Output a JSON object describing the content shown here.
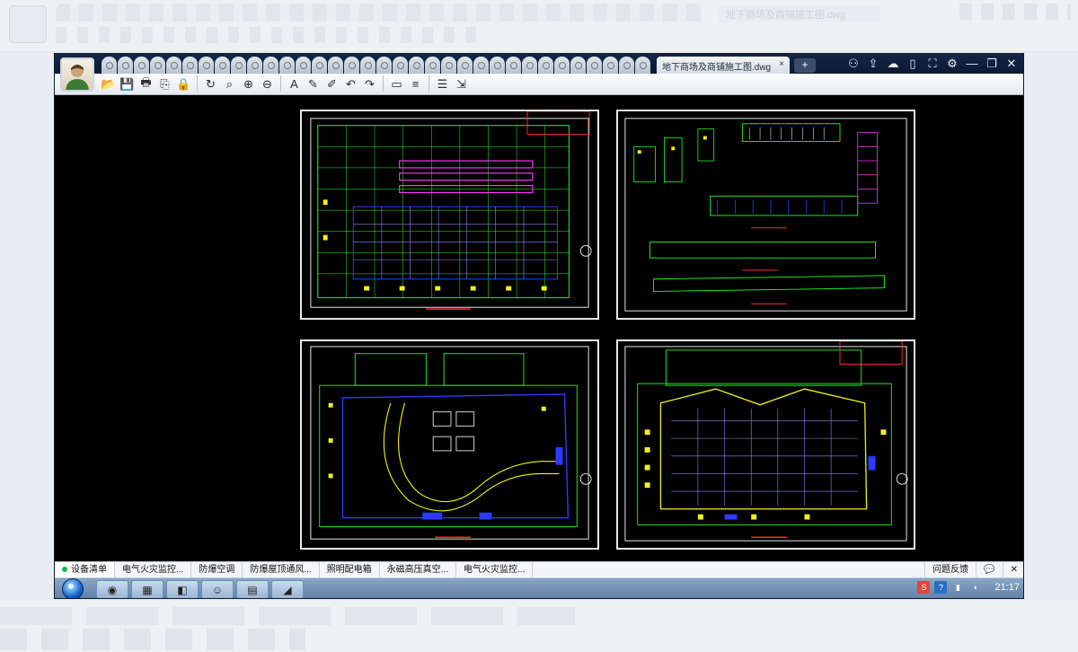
{
  "window": {
    "document_tab": "地下商场及商铺施工图.dwg",
    "close_tab": "×",
    "new_tab": "+",
    "controls": [
      "⚇",
      "⇪",
      "☁",
      "▯",
      "⛶",
      "⚙",
      "—",
      "❐",
      "✕"
    ]
  },
  "toolbar": {
    "tools": [
      {
        "name": "open-icon",
        "glyph": "📂"
      },
      {
        "name": "save-icon",
        "glyph": "💾"
      },
      {
        "name": "print-icon",
        "glyph": "🖶"
      },
      {
        "name": "pdf-icon",
        "glyph": "⎘"
      },
      {
        "name": "lock-icon",
        "glyph": "🔒"
      },
      {
        "sep": true
      },
      {
        "name": "rotate-icon",
        "glyph": "↻"
      },
      {
        "name": "zoom-window-icon",
        "glyph": "⌕"
      },
      {
        "name": "zoom-in-icon",
        "glyph": "⊕"
      },
      {
        "name": "zoom-out-icon",
        "glyph": "⊖"
      },
      {
        "sep": true
      },
      {
        "name": "text-icon",
        "glyph": "A"
      },
      {
        "name": "pencil-icon",
        "glyph": "✎"
      },
      {
        "name": "highlighter-icon",
        "glyph": "✐"
      },
      {
        "name": "undo-icon",
        "glyph": "↶"
      },
      {
        "name": "redo-icon",
        "glyph": "↷"
      },
      {
        "sep": true
      },
      {
        "name": "measure-icon",
        "glyph": "▭"
      },
      {
        "name": "dimension-icon",
        "glyph": "≡"
      },
      {
        "sep": true
      },
      {
        "name": "layers-icon",
        "glyph": "☰"
      },
      {
        "name": "export-icon",
        "glyph": "⇲"
      }
    ]
  },
  "sheets": [
    {
      "id": "plan-a",
      "label": ""
    },
    {
      "id": "elevations",
      "label": ""
    },
    {
      "id": "plan-b",
      "label": ""
    },
    {
      "id": "plan-c",
      "label": ""
    }
  ],
  "sheet_tabs": [
    {
      "label": "设备清单",
      "active": true
    },
    {
      "label": "电气火灾监控...",
      "active": false
    },
    {
      "label": "防爆空调",
      "active": false
    },
    {
      "label": "防爆屋顶通风...",
      "active": false
    },
    {
      "label": "照明配电箱",
      "active": false
    },
    {
      "label": "永磁高压真空...",
      "active": false
    },
    {
      "label": "电气火灾监控...",
      "active": false
    }
  ],
  "sheetbar_right": {
    "feedback": "问题反馈",
    "chat": "💬",
    "close": "✕"
  },
  "taskbar": {
    "start": "",
    "apps": [
      "◉",
      "▦",
      "◧",
      "☺",
      "▤",
      "◢"
    ],
    "tray": {
      "ime": "S",
      "help": "?",
      "clock": "21:17"
    }
  },
  "colors": {
    "canvas": "#000000",
    "green": "#22ff22",
    "yellow": "#f2f21a",
    "blue": "#2a3cff",
    "magenta": "#ff33ff",
    "red": "#ff2a2a",
    "white": "#e8e8e8"
  }
}
